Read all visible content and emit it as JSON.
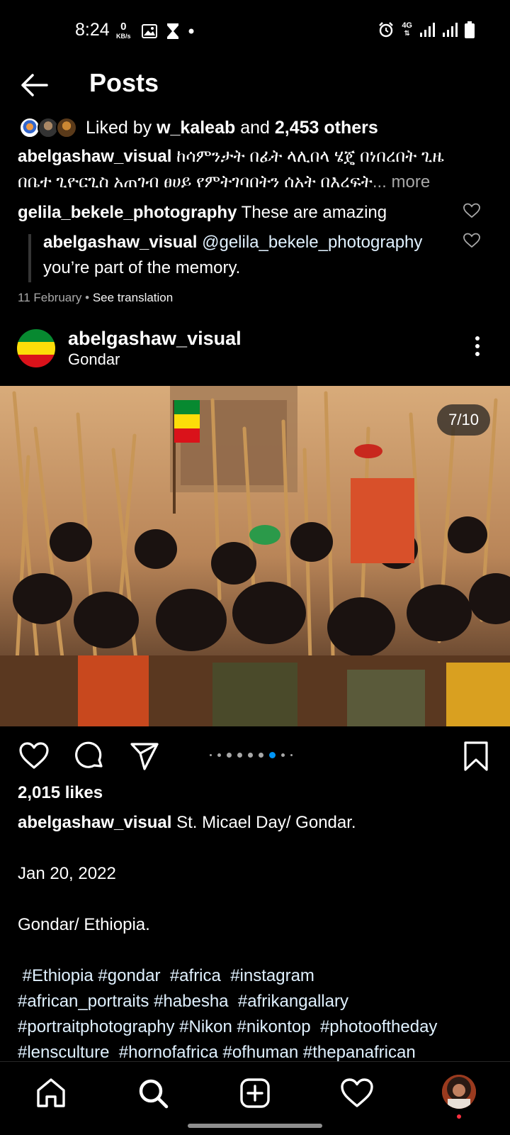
{
  "status_bar": {
    "time": "8:24",
    "data_rate_value": "0",
    "data_rate_unit": "KB/s",
    "network": "4G"
  },
  "header": {
    "title": "Posts"
  },
  "previous_post": {
    "liked_by_prefix": "Liked by",
    "liked_by_user": "w_kaleab",
    "liked_by_and": "and",
    "liked_by_others": "2,453 others",
    "caption_user": "abelgashaw_visual",
    "caption_text": "ከሳምንታት በፊት ላሊበላ ሄጄ በነበረበት ጊዜ በቤተ ጊዮርጊስ አጠገብ ፀሀይ የምትገባበትን ሰአት በእረፍት",
    "caption_more": "... more",
    "comment_user": "gelila_bekele_photography",
    "comment_text": "These are amazing",
    "reply_user": "abelgashaw_visual",
    "reply_mention": "@gelila_bekele_photography",
    "reply_text": "you’re part of the memory.",
    "date": "11 February",
    "see_translation": "See translation"
  },
  "post": {
    "username": "abelgashaw_visual",
    "location": "Gondar",
    "image_counter": "7/10",
    "carousel_total": 10,
    "carousel_current": 7,
    "likes": "2,015 likes",
    "caption_user": "abelgashaw_visual",
    "caption_line1": "St. Micael Day/ Gondar.",
    "caption_date": "Jan 20, 2022",
    "caption_place": "Gondar/ Ethiopia.",
    "hashtags_line1": " #Ethiopia #gondar  #africa  #instagram",
    "hashtags_line2": "#african_portraits #habesha  #afrikangallary",
    "hashtags_line3": "#portraitphotography #Nikon #nikontop  #photooftheday",
    "hashtags_line4": "#lensculture  #hornofafrica #ofhuman #thepanafrican"
  },
  "icons": {
    "back": "arrow-left-icon",
    "more": "more-vertical-icon",
    "like": "heart-icon",
    "comment": "comment-icon",
    "share": "send-icon",
    "save": "bookmark-icon",
    "nav": [
      "home-icon",
      "search-icon",
      "add-post-icon",
      "activity-heart-icon",
      "profile-avatar"
    ]
  },
  "colors": {
    "background": "#000000",
    "text": "#ffffff",
    "secondary_text": "#a8a8a8",
    "accent_dot": "#0095f6",
    "flag_green": "#078930",
    "flag_yellow": "#fcdd09",
    "flag_red": "#da121a"
  }
}
